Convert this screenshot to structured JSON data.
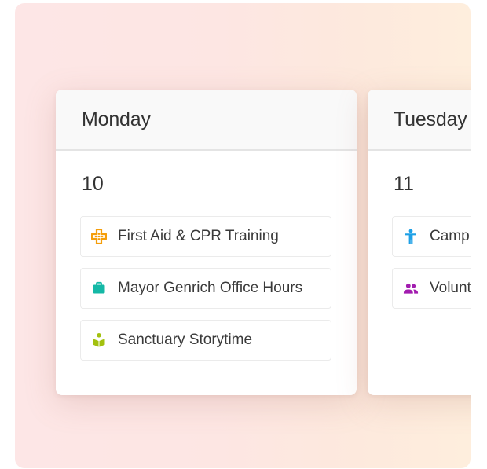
{
  "days": [
    {
      "name": "Monday",
      "date": "10",
      "events": [
        {
          "title": "First Aid & CPR Training",
          "icon": "first-aid-icon",
          "color": "#f59e0b"
        },
        {
          "title": "Mayor Genrich Office Hours",
          "icon": "briefcase-icon",
          "color": "#14b8a6"
        },
        {
          "title": "Sanctuary Storytime",
          "icon": "book-reader-icon",
          "color": "#a3c10f"
        }
      ]
    },
    {
      "name": "Tuesday",
      "date": "11",
      "events": [
        {
          "title": "Camp",
          "icon": "person-icon",
          "color": "#1ea0e6"
        },
        {
          "title": "Volunt",
          "icon": "group-icon",
          "color": "#a21caf"
        }
      ]
    }
  ]
}
